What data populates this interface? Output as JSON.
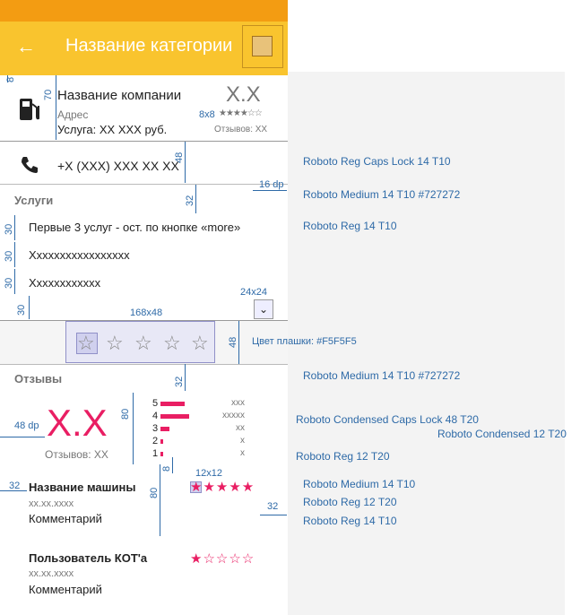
{
  "appbar": {
    "back_icon": "arrow-left-icon",
    "title": "Название категории"
  },
  "company": {
    "name": "Название компании",
    "address": "Адрес",
    "service": "Услуга: XX XXX руб.",
    "rating": "X.X",
    "reviews": "Отзывов: XX",
    "star_label": "8x8",
    "icon": "gas-station-icon"
  },
  "phone": {
    "icon": "phone-icon",
    "number": "+X (XXX) XXX XX XX"
  },
  "services": {
    "header": "Услуги",
    "items": [
      "Первые 3 услуг - ост. по кнопке «more»",
      "Xxxxxxxxxxxxxxxxx",
      "Xxxxxxxxxxxx"
    ],
    "expand_icon": "chevron-down-icon"
  },
  "rate_bar": {
    "size_label": "168x48",
    "color_note": "Цвет плашки: #F5F5F5",
    "stars": 5
  },
  "reviews": {
    "header": "Отзывы",
    "score": "X.X",
    "count": "Отзывов: XX",
    "dist": [
      {
        "label": "5",
        "count": "xxx",
        "value": 0.85
      },
      {
        "label": "4",
        "count": "xxxxx",
        "value": 1.0
      },
      {
        "label": "3",
        "count": "xx",
        "value": 0.3
      },
      {
        "label": "2",
        "count": "x",
        "value": 0.1
      },
      {
        "label": "1",
        "count": "x",
        "value": 0.1
      }
    ],
    "star_size": "12x12",
    "items": [
      {
        "author": "Название машины",
        "date": "xx.xx.xxxx",
        "comment": "Комментарий",
        "stars": "★★★★★"
      },
      {
        "author": "Пользователь КОТ'а",
        "date": "xx.xx.xxxx",
        "comment": "Комментарий",
        "stars": "★☆☆☆☆"
      }
    ]
  },
  "dims": {
    "d8a": "8",
    "d70": "70",
    "d48": "48",
    "d16": "16 dp",
    "d32": "32",
    "d30a": "30",
    "d30b": "30",
    "d30c": "30",
    "d30d": "30",
    "d24": "24x24",
    "d48b": "48",
    "d32b": "32",
    "d48dp": "48 dp",
    "d80": "80",
    "d8b": "8",
    "d32c": "32",
    "d80b": "80",
    "d32d": "32"
  },
  "notes": [
    "Roboto Reg Caps Lock 14 T10",
    "Roboto Medium  14 T10 #727272",
    "Roboto Reg  14 T10",
    "Roboto Medium  14 T10 #727272",
    "Roboto Condensed Caps Lock 48 T20",
    "Roboto Condensed 12 T20",
    "Roboto Reg 12 T20",
    "Roboto Medium  14 T10",
    "Roboto Reg 12 T20",
    "Roboto Reg 14 T10"
  ]
}
